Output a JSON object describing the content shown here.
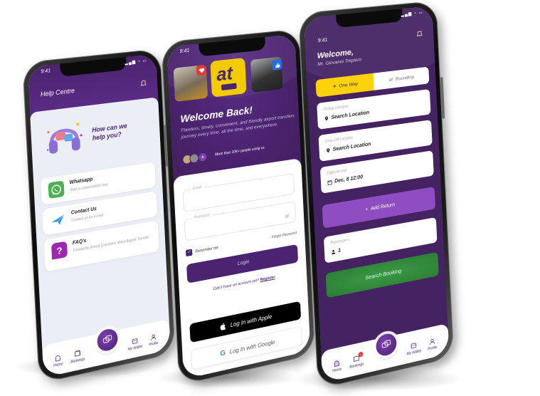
{
  "status_bar": {
    "time": "9:41",
    "icons": "signal-wifi-battery"
  },
  "phones": {
    "help_centre": {
      "header": {
        "title": "Help Centre",
        "notification_icon": "bell-icon"
      },
      "hero": {
        "text_line1": "How can we",
        "text_line2": "help you?",
        "illustration": "headphones-chat-illustration"
      },
      "cards": [
        {
          "title": "Whatsapp",
          "subtitle": "Start a conversation now",
          "icon": "whatsapp-icon",
          "color": "#4caf50"
        },
        {
          "title": "Contact Us",
          "subtitle": "Contact us by e-mail",
          "icon": "paper-plane-icon",
          "color": "#2196f3"
        },
        {
          "title": "FAQ's",
          "subtitle": "Frequently Asked Questions about Airport Transfer",
          "icon": "question-bubble-icon",
          "color": "#9c27b0"
        }
      ],
      "tabbar": {
        "items": [
          {
            "label": "Home",
            "icon": "home-icon"
          },
          {
            "label": "Bookings",
            "icon": "bookings-icon"
          },
          {
            "label": "My Wallet",
            "icon": "wallet-icon"
          },
          {
            "label": "Profile",
            "icon": "profile-icon"
          }
        ],
        "center_icon": "chat-bubbles-icon"
      }
    },
    "login": {
      "tiles": {
        "like_icon": "heart-icon",
        "logo_text": "at",
        "thumb_icon": "thumbs-up-icon"
      },
      "title": "Welcome Back!",
      "description": "Flawless, timely, convenient, and friendly airport transfers journey every time, all the time, and everywhere.",
      "social_proof": {
        "plus_label": "+",
        "text": "More than 10K+ people using us"
      },
      "form": {
        "email_label": "Email",
        "email_value": "",
        "password_label": "Password",
        "password_value": "",
        "remember_label": "Remember me",
        "remember_checked": true,
        "forgot_label": "Forgot Password",
        "login_label": "Login",
        "register_prompt": "Don't have an account yet?",
        "register_link": "Register"
      },
      "apple_label": "Log In with Apple",
      "google_label": "Log In with Google"
    },
    "booking": {
      "welcome": "Welcome,",
      "user_name": "Mr. Giovanni Trepiero",
      "trip_type": {
        "options": [
          {
            "label": "One Way",
            "icon": "plane-icon",
            "active": true
          },
          {
            "label": "Roundtrip",
            "icon": "swap-icon",
            "active": false
          }
        ]
      },
      "fields": [
        {
          "label": "Pickup Location",
          "value": "Search Location",
          "icon": "location-pin-icon"
        },
        {
          "label": "Drop-Off Location",
          "value": "Search Location",
          "icon": "location-pin-icon"
        },
        {
          "label": "Flight Arrival",
          "value": "Dec, 8 12:00",
          "icon": "calendar-icon"
        }
      ],
      "add_return_label": "Add Return",
      "passengers": {
        "label": "Passengers",
        "value": "1",
        "icon": "person-icon"
      },
      "search_label": "Search Booking",
      "tabbar": {
        "items": [
          {
            "label": "Home",
            "icon": "home-icon"
          },
          {
            "label": "Bookings",
            "icon": "bookings-icon",
            "badge": "1"
          },
          {
            "label": "My Wallet",
            "icon": "wallet-icon"
          },
          {
            "label": "Profile",
            "icon": "profile-icon"
          }
        ],
        "center_icon": "chat-bubbles-icon"
      }
    }
  },
  "colors": {
    "brand_purple": "#4b2370",
    "accent_purple": "#8e4dc0",
    "accent_yellow": "#fdd20a",
    "search_green": "#2e8b3a",
    "help_bg": "#eceef6"
  }
}
